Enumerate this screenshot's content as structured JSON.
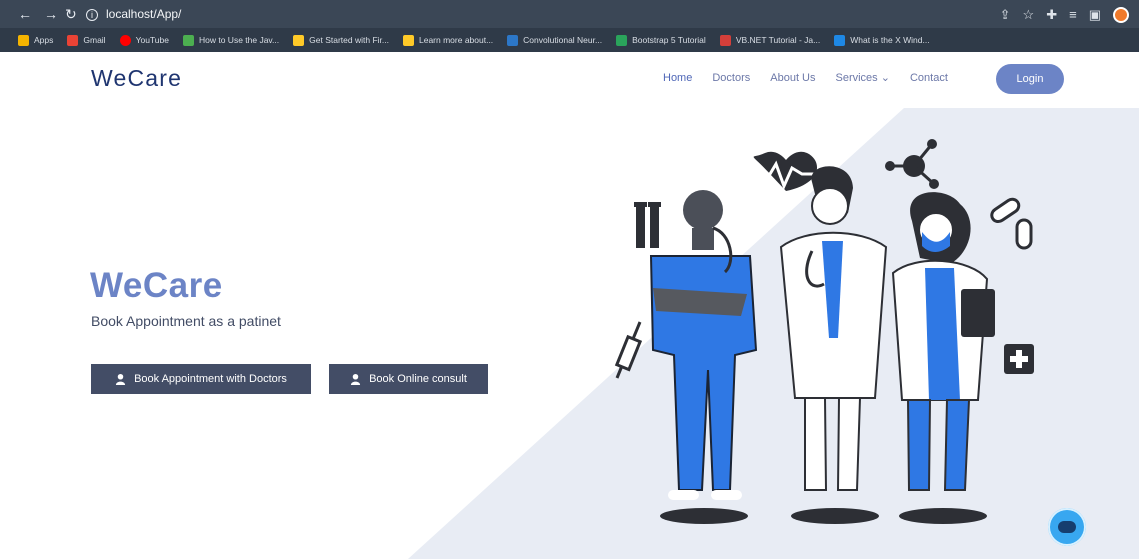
{
  "browser": {
    "back_icon": "left-arrow",
    "forward_icon": "right-arrow",
    "reload_icon": "reload",
    "url": "localhost/App/",
    "bookmarks": [
      {
        "label": "Apps",
        "icon": "grid-icon",
        "color": "#f5b400"
      },
      {
        "label": "Gmail",
        "icon": "gmail-icon",
        "color": "#ea4335"
      },
      {
        "label": "YouTube",
        "icon": "youtube-icon",
        "color": "#ff0000"
      },
      {
        "label": "How to Use the Jav...",
        "icon": "site-icon",
        "color": "#4caf50"
      },
      {
        "label": "Get Started with Fir...",
        "icon": "firebase-icon",
        "color": "#ffca28"
      },
      {
        "label": "Learn more about...",
        "icon": "firebase-icon",
        "color": "#ffca28"
      },
      {
        "label": "Convolutional Neur...",
        "icon": "site-icon",
        "color": "#2c77c8"
      },
      {
        "label": "Bootstrap 5 Tutorial",
        "icon": "site-icon",
        "color": "#2aa45b"
      },
      {
        "label": "VB.NET Tutorial - Ja...",
        "icon": "site-icon",
        "color": "#d43f3a"
      },
      {
        "label": "What is the X Wind...",
        "icon": "site-icon",
        "color": "#1e88e5"
      }
    ]
  },
  "site": {
    "logo": "WeCare",
    "menu": {
      "home": "Home",
      "doctors": "Doctors",
      "about": "About Us",
      "services": "Services",
      "contact": "Contact"
    },
    "login": "Login"
  },
  "hero": {
    "title": "WeCare",
    "subtitle": "Book Appointment as a patinet",
    "button_doctors": "Book Appointment with Doctors",
    "button_online": "Book Online consult"
  },
  "colors": {
    "brand": "#6c84c6",
    "dark_button": "#434d66",
    "hero_panel": "#e8ecf4",
    "illustration_blue": "#2f78e4"
  }
}
